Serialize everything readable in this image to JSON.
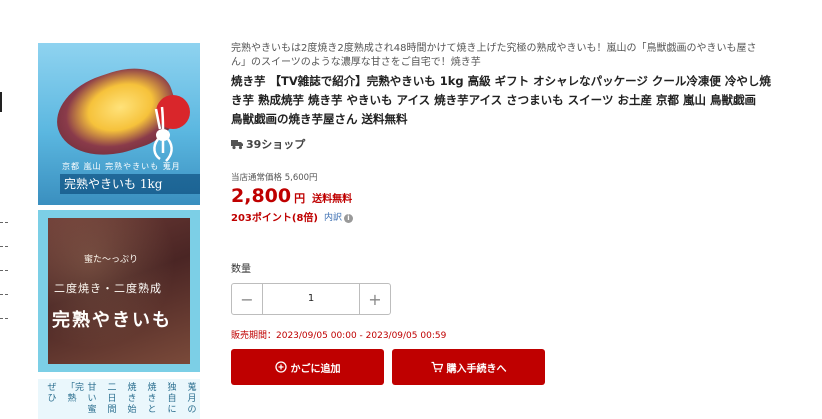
{
  "product": {
    "description": "完熟やきいもは2度焼き2度熟成され48時間かけて焼き上げた究極の熟成やきいも！嵐山の「鳥獣戯画のやきいも屋さん」のスイーツのような濃厚な甘さをご自宅で！焼き芋",
    "title": "焼き芋 【TV雑誌で紹介】完熟やきいも 1kg 高級 ギフト オシャレなパッケージ クール冷凍便 冷やし焼き芋 熟成焼芋 焼き芋 やきいも アイス 焼き芋アイス さつまいも スイーツ お土産 京都 嵐山 鳥獣戯画 鳥獣戯画の焼き芋屋さん 送料無料",
    "shop_label": "39ショップ"
  },
  "pricing": {
    "reference_label": "当店通常価格",
    "reference_price": "5,600円",
    "price": "2,800",
    "currency": "円",
    "shipping": "送料無料",
    "points": "203ポイント(8倍)",
    "points_breakdown": "内訳"
  },
  "quantity": {
    "label": "数量",
    "value": "1",
    "minus": "−",
    "plus": "+"
  },
  "sale_period": "販売期間：2023/09/05 00:00 - 2023/09/05 00:59",
  "actions": {
    "add_to_cart": "かごに追加",
    "buy_now": "購入手続きへ"
  },
  "images": {
    "thumb1_small": "京都 嵐山 完熟やきいも 蒐月",
    "thumb1_band": "完熟やきいも 1kg",
    "thumb2_line1": "蜜た〜っぷり",
    "thumb2_line2": "二度焼き・二度熟成",
    "thumb2_line3": "完熟やきいも",
    "thumb3_cols": [
      "甘い蜜",
      "二日間",
      "焼き始",
      "焼きと",
      "独自に",
      "蒐月の",
      "「完熟",
      "ぜひ"
    ]
  },
  "colors": {
    "accent_red": "#bf0000",
    "link_blue": "#3c6fb2"
  },
  "icons": {
    "shop": "truck-icon",
    "info": "info-icon",
    "cart": "cart-icon",
    "add": "plus-circle-icon"
  }
}
